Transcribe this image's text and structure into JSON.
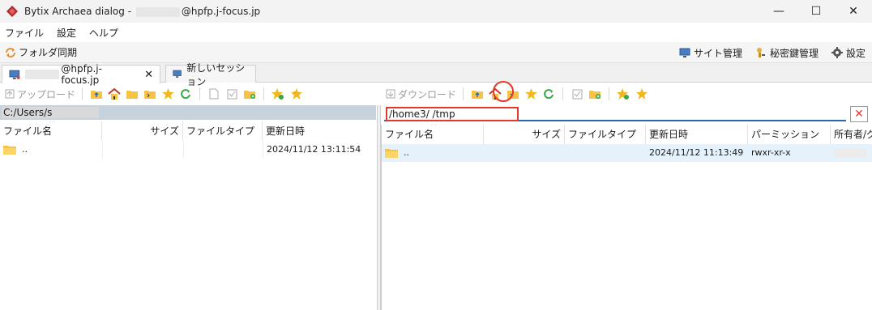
{
  "window": {
    "title_prefix": "Bytix Archaea dialog - ",
    "title_suffix": "@hpfp.j-focus.jp",
    "controls": {
      "minimize": "—",
      "maximize": "☐",
      "close": "✕"
    }
  },
  "menu": [
    "ファイル",
    "設定",
    "ヘルプ"
  ],
  "sync": {
    "label": "フォルダ同期"
  },
  "top_tools": {
    "site_manager": "サイト管理",
    "secret_key": "秘密鍵管理",
    "settings": "設定"
  },
  "tabs": [
    {
      "label": "@hpfp.j-focus.jp",
      "close": "✕"
    },
    {
      "label": "新しいセッション"
    }
  ],
  "left_toolbar": {
    "upload": "アップロード"
  },
  "right_toolbar": {
    "download": "ダウンロード"
  },
  "left_path": {
    "value": "C:/Users/s"
  },
  "right_path": {
    "value": "/home3/                    /tmp",
    "clear": "✕"
  },
  "left_columns": [
    "ファイル名",
    "サイズ",
    "ファイルタイプ",
    "更新日時"
  ],
  "left_rows": [
    {
      "name": "..",
      "size": "",
      "type": "",
      "modified": "2024/11/12 13:11:54"
    }
  ],
  "right_columns": [
    "ファイル名",
    "サイズ",
    "ファイルタイプ",
    "更新日時",
    "パーミッション",
    "所有者/グ"
  ],
  "right_rows": [
    {
      "name": "..",
      "size": "",
      "type": "",
      "modified": "2024/11/12 11:13:49",
      "permission": "rwxr-xr-x",
      "owner": ""
    }
  ],
  "colors": {
    "highlight_red": "#e2392a",
    "selection_blue": "#e5f1fb",
    "folder_yellow": "#f6c344",
    "accent_blue": "#2a66b3",
    "refresh_green": "#3ea64a",
    "star_yellow": "#f2b71b"
  },
  "icons": {
    "logo": "app-logo-icon",
    "sync": "sync-icon",
    "site_manager": "monitor-icon",
    "secret_key": "key-person-icon",
    "settings": "gear-icon"
  }
}
